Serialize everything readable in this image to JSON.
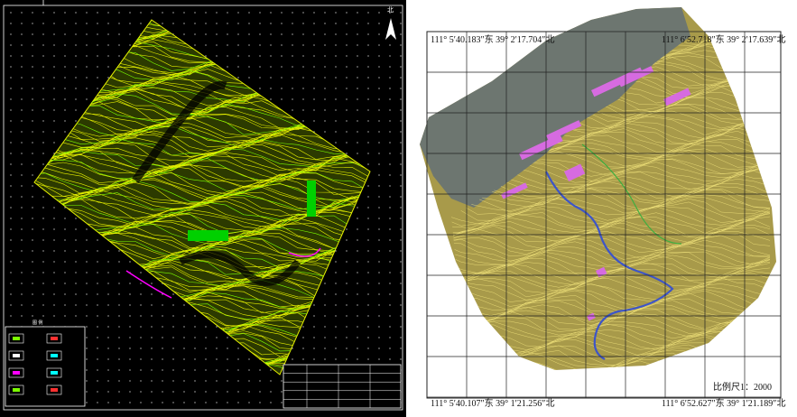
{
  "left_panel": {
    "north_label": "北",
    "legend_title": "图 例",
    "colors": {
      "background": "#000000",
      "contour": "#e6f000",
      "contour_alt": "#7cff00",
      "road": "#ff00ff",
      "water": "#00ffff"
    }
  },
  "right_panel": {
    "corners": {
      "top_left": "111° 5′40.183″东  39° 2′17.704″北",
      "top_right": "111° 6′52.718″东  39° 2′17.639″北",
      "bottom_left": "111° 5′40.107″东  39° 1′21.256″北",
      "bottom_right": "111° 6′52.627″东  39° 1′21.189″北"
    },
    "scale_label": "比例尺1：2000",
    "colors": {
      "terrain": "#a89a4a",
      "contour": "#f0e27a",
      "building": "#d66be0",
      "river": "#3d55c8",
      "stream": "#3fae3f",
      "grid": "#222222"
    }
  }
}
